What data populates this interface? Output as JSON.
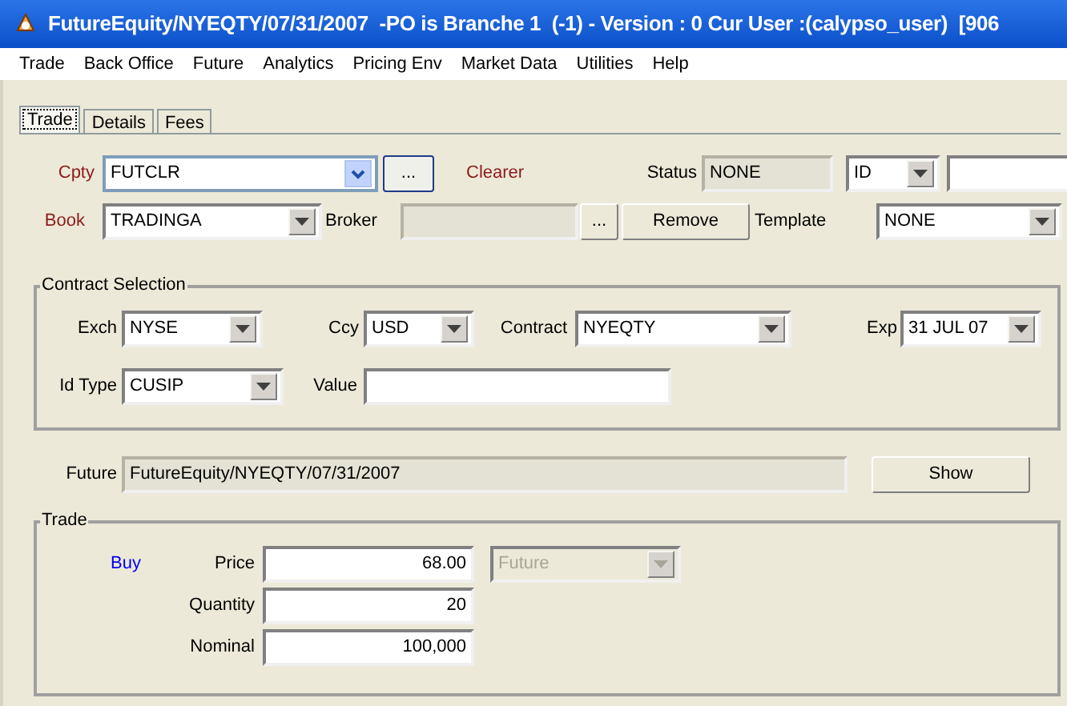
{
  "window": {
    "title": "FutureEquity/NYEQTY/07/31/2007  -PO is Branche 1  (-1) - Version : 0 Cur User :(calypso_user)  [906"
  },
  "menu": [
    "Trade",
    "Back Office",
    "Future",
    "Analytics",
    "Pricing Env",
    "Market Data",
    "Utilities",
    "Help"
  ],
  "tabs": [
    {
      "label": "Trade",
      "selected": true
    },
    {
      "label": "Details",
      "selected": false
    },
    {
      "label": "Fees",
      "selected": false
    }
  ],
  "cpty": {
    "label": "Cpty",
    "value": "FUTCLR",
    "focused": true,
    "button": "...",
    "role": "Clearer"
  },
  "status": {
    "label": "Status",
    "value": "NONE",
    "disabled": true
  },
  "id_filter": {
    "value": "ID"
  },
  "book": {
    "label": "Book",
    "value": "TRADINGA"
  },
  "broker": {
    "label": "Broker",
    "disabled": true,
    "button": "...",
    "remove": "Remove"
  },
  "template": {
    "label": "Template",
    "value": "NONE"
  },
  "contract_selection": {
    "title": "Contract Selection",
    "exch": {
      "label": "Exch",
      "value": "NYSE"
    },
    "ccy": {
      "label": "Ccy",
      "value": "USD"
    },
    "contract": {
      "label": "Contract",
      "value": "NYEQTY"
    },
    "exp": {
      "label": "Exp",
      "value": "31 JUL 07"
    },
    "id_type": {
      "label": "Id Type",
      "value": "CUSIP"
    },
    "value": {
      "label": "Value"
    }
  },
  "future": {
    "label": "Future",
    "value": "FutureEquity/NYEQTY/07/31/2007",
    "disabled": true,
    "button": "Show"
  },
  "trade": {
    "title": "Trade",
    "direction": "Buy",
    "fields": [
      {
        "label": "Price",
        "value": "68.00"
      },
      {
        "label": "Quantity",
        "value": "20"
      },
      {
        "label": "Nominal",
        "value": "100,000"
      }
    ],
    "price_type": {
      "value": "Future",
      "disabled": true
    }
  }
}
